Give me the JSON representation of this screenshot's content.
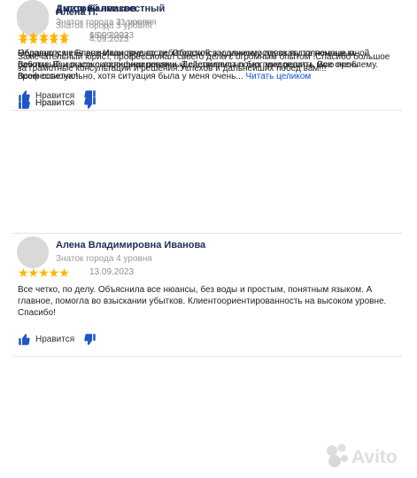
{
  "reviews": [
    {
      "name": "Алена П.",
      "level": "Знаток города 3 уровня",
      "stars": "★★★★★",
      "date": "4.09.2023",
      "text": "Замечательный юрист, профессионал своего дела с огромным опытом !Спасибо большое за грамотные консультации и решения.Успехов и дальнейших побед вам!!!",
      "like_label": "Нравится"
    },
    {
      "name": "Алена Владимировна Иванова",
      "level": "Знаток города 4 уровня",
      "stars": "★★★★★",
      "date": "13.09.2023",
      "text": "Все четко, по делу. Объяснила все нюансы, без воды и простым, понятным языком. А главное, помогла во взыскании убытков. Клиентоориентированность на высоком уровне. Спасибо!",
      "like_label": "Нравится"
    },
    {
      "name": "Антон Балмасов",
      "level": "Знаток города 11 уровня",
      "stars": "★★★★★",
      "date": "18.09.2023",
      "text": "Недавно у меня возникли трудности. Обратился к данному адвокату за помощью. Вежливый и высококвалифицированный специалист помог мне решить мою проблему. Всем советую!",
      "like_label": "Нравится"
    },
    {
      "name": "Дмитрий неизвестный",
      "level": "Знаток города 3 уровня",
      "stars": "★★★★★",
      "date": "6.09.2023",
      "text": "Обращался к Елене Ивановне по дебиторской задолженности за выполненные мной работы. Взыскали с хорошими пенями. Действительно без предоплаты. Все очень профессионально, хотя ситуация была у меня очень...",
      "more_label": "Читать целиком",
      "like_label": "Нравится"
    }
  ],
  "watermark": {
    "text": "Avito",
    "icon": "avito-logo"
  },
  "colors": {
    "star": "#ffb400",
    "name": "#1f2d54",
    "link": "#0a56d4",
    "meta": "#9b9b9b"
  }
}
